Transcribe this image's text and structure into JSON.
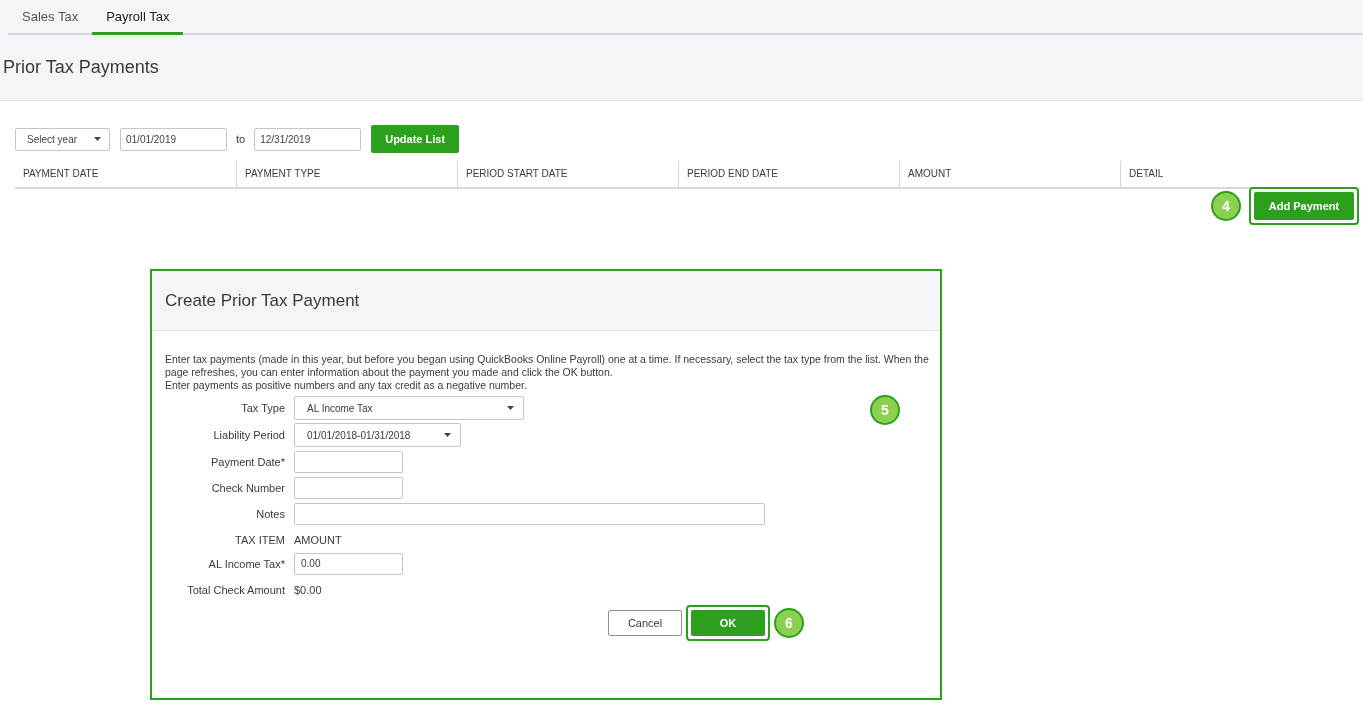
{
  "tabs": [
    {
      "label": "Sales Tax",
      "selected": false
    },
    {
      "label": "Payroll Tax",
      "selected": true
    }
  ],
  "title": "Prior Tax Payments",
  "filter": {
    "year_select": "Select year",
    "from": "01/01/2019",
    "to_label": "to",
    "to": "12/31/2019",
    "button": "Update List"
  },
  "table": {
    "columns": [
      "PAYMENT DATE",
      "PAYMENT TYPE",
      "PERIOD START DATE",
      "PERIOD END DATE",
      "AMOUNT",
      "DETAIL"
    ]
  },
  "add_payment": {
    "label": "Add Payment",
    "step": "4"
  },
  "dialog": {
    "title": "Create Prior Tax Payment",
    "step": "5",
    "instructions": [
      "Enter tax payments (made in this year, but before you began using QuickBooks Online Payroll) one at a time. If necessary, select the tax type from the list. When the page refreshes, you can enter information about the payment you made and click the OK button.",
      "Enter payments as positive numbers and any tax credit as a negative number."
    ],
    "fields": [
      {
        "kind": "select",
        "label": "Tax Type",
        "value": "AL Income Tax"
      },
      {
        "kind": "select",
        "label": "Liability Period",
        "value": "01/01/2018-01/31/2018"
      },
      {
        "kind": "input",
        "label": "Payment Date*"
      },
      {
        "kind": "input",
        "label": "Check Number"
      },
      {
        "kind": "input",
        "label": "Notes"
      }
    ],
    "tax_item_header": "TAX ITEM",
    "amount_header": "AMOUNT",
    "tax_items": [
      {
        "label": "AL Income Tax*",
        "value": "0.00"
      }
    ],
    "total_label": "Total Check Amount",
    "total_value": "$0.00",
    "cancel": "Cancel",
    "ok": "OK",
    "ok_step": "6"
  }
}
